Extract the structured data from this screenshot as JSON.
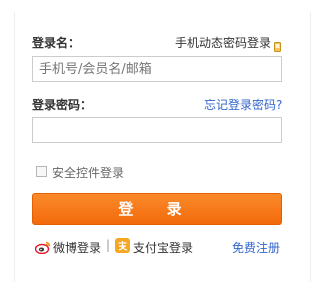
{
  "form": {
    "username_label": "登录名：",
    "mobile_login_link": "手机动态密码登录",
    "username_placeholder": "手机号/会员名/邮箱",
    "password_label": "登录密码：",
    "forgot_link": "忘记登录密码?",
    "password_value": "",
    "secure_login_label": "安全控件登录",
    "submit_label": "登 录"
  },
  "footer": {
    "weibo_label": "微博登录",
    "separator": "|",
    "alipay_label": "支付宝登录",
    "register_label": "免费注册"
  },
  "colors": {
    "accent": "#f26a0b",
    "link_blue": "#3366cc",
    "text": "#333333"
  },
  "icons": {
    "mobile": "mobile-phone-icon",
    "weibo": "weibo-icon",
    "alipay": "alipay-icon"
  }
}
